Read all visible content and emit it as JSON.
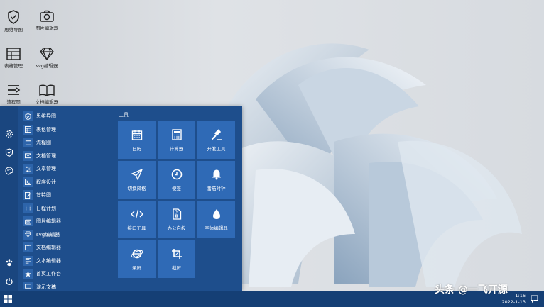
{
  "desktop_icons": [
    {
      "label": "思维导图",
      "icon": "shield-check-icon"
    },
    {
      "label": "图片编辑器",
      "icon": "camera-icon"
    },
    {
      "label": "表格管理",
      "icon": "table-icon"
    },
    {
      "label": "svg编辑器",
      "icon": "diamond-icon"
    },
    {
      "label": "流程图",
      "icon": "flow-icon"
    },
    {
      "label": "文档编辑器",
      "icon": "book-icon"
    }
  ],
  "start_menu": {
    "rail": [
      "settings-icon",
      "shield-icon",
      "palette-icon",
      "paw-icon",
      "power-icon"
    ],
    "apps": [
      {
        "label": "思维导图",
        "icon": "shield-check-icon"
      },
      {
        "label": "表格管理",
        "icon": "table-icon"
      },
      {
        "label": "流程图",
        "icon": "list-icon"
      },
      {
        "label": "文档管理",
        "icon": "mail-icon"
      },
      {
        "label": "文章管理",
        "icon": "sliders-icon"
      },
      {
        "label": "程序设计",
        "icon": "code-icon"
      },
      {
        "label": "甘特图",
        "icon": "edit-icon"
      },
      {
        "label": "日程计划",
        "icon": "grid-icon"
      },
      {
        "label": "图片编辑器",
        "icon": "camera-icon"
      },
      {
        "label": "svg编辑器",
        "icon": "diamond-icon"
      },
      {
        "label": "文档编辑器",
        "icon": "book-icon"
      },
      {
        "label": "文本编辑器",
        "icon": "text-icon"
      },
      {
        "label": "首页工作台",
        "icon": "star-icon"
      },
      {
        "label": "演示文稿",
        "icon": "slides-icon"
      }
    ],
    "tiles_title": "工具",
    "tiles": [
      {
        "label": "日历",
        "icon": "calendar-icon"
      },
      {
        "label": "计算器",
        "icon": "calculator-icon"
      },
      {
        "label": "开发工具",
        "icon": "gavel-icon"
      },
      {
        "label": "切换风格",
        "icon": "send-icon"
      },
      {
        "label": "便签",
        "icon": "clock-icon"
      },
      {
        "label": "番茄时钟",
        "icon": "bell-icon"
      },
      {
        "label": "接口工具",
        "icon": "code-icon"
      },
      {
        "label": "办公白板",
        "icon": "file-zip-icon"
      },
      {
        "label": "字体编辑器",
        "icon": "drop-icon"
      },
      {
        "label": "录屏",
        "icon": "ie-icon"
      },
      {
        "label": "截屏",
        "icon": "crop-icon"
      }
    ]
  },
  "taskbar": {
    "time": "1:16",
    "date": "2022-1-13"
  },
  "watermark": "头条 @一飞开源",
  "colors": {
    "menu_bg": "#1e4e8c",
    "tile_bg": "#2f6ab6",
    "taskbar_bg": "#153f75"
  }
}
